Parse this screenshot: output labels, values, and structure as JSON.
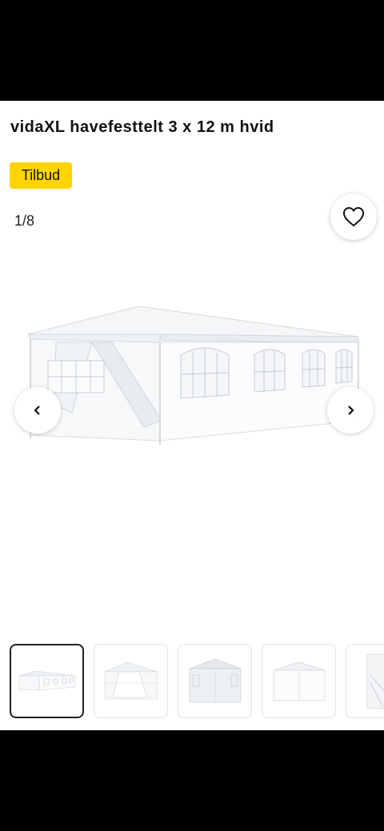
{
  "product": {
    "title": "vidaXL havefesttelt 3 x 12 m hvid",
    "badge": "Tilbud"
  },
  "gallery": {
    "current": 1,
    "total": 8,
    "counter_text": "1/8",
    "main_image_icon": "tent-image",
    "prev_icon": "chevron-left-icon",
    "next_icon": "chevron-right-icon",
    "favorite_icon": "heart-icon",
    "thumbnails": [
      {
        "name": "thumbnail-1",
        "active": true
      },
      {
        "name": "thumbnail-2",
        "active": false
      },
      {
        "name": "thumbnail-3",
        "active": false
      },
      {
        "name": "thumbnail-4",
        "active": false
      },
      {
        "name": "thumbnail-5",
        "active": false
      }
    ]
  },
  "colors": {
    "badge": "#ffd400",
    "background": "#ffffff",
    "system_bars": "#000000"
  }
}
